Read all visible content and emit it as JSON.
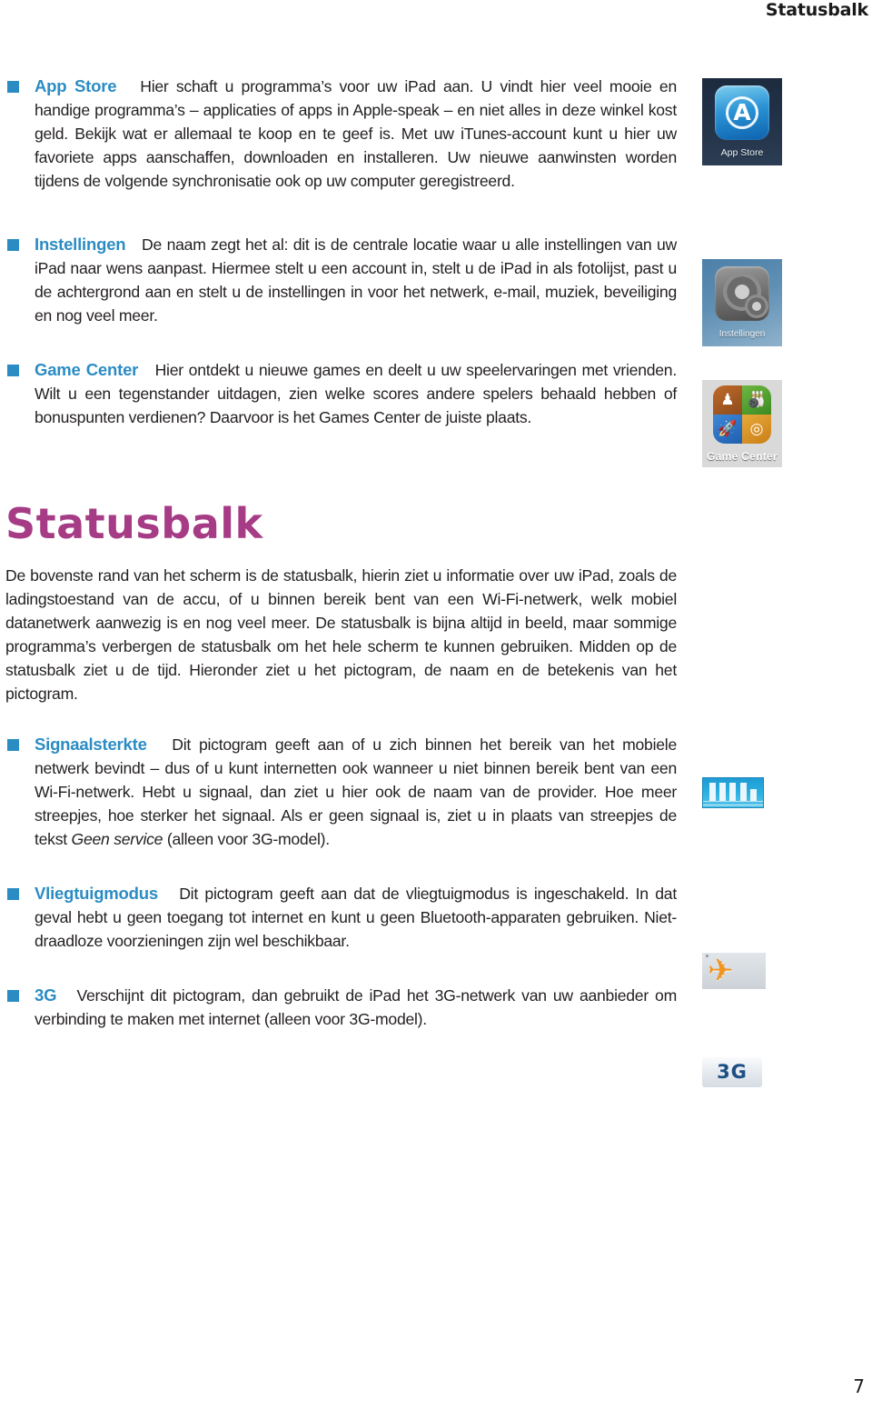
{
  "header": {
    "running_head": "Statusbalk"
  },
  "colors": {
    "term_blue": "#2b8cc4",
    "bullet_blue": "#2b8cc4",
    "heading_magenta": "#a63b86",
    "body_text": "#231f20"
  },
  "entries": [
    {
      "term": "App Store",
      "body": "Hier schaft u programma’s voor uw iPad aan. U vindt hier veel mooie en handige programma’s – applicaties of apps in Apple-speak – en niet alles in deze winkel kost geld. Bekijk wat er allemaal te koop en te geef is. Met uw iTunes-account kunt u hier uw favoriete apps aanschaffen, downloaden en installeren. Uw nieuwe aanwinsten worden tijdens de volgende synchronisatie ook op uw computer geregistreerd.",
      "icon": {
        "name": "app-store-icon",
        "caption": "App Store",
        "glyph": "A"
      }
    },
    {
      "term": "Instellingen",
      "body": "De naam zegt het al: dit is de centrale locatie waar u alle instellingen van uw iPad naar wens aanpast. Hiermee stelt u een account in, stelt u de iPad in als fotolijst, past u de achtergrond aan en stelt u de instellingen in voor het netwerk, e-mail, muziek, beveiliging en nog veel meer.",
      "icon": {
        "name": "settings-gears-icon",
        "caption": "Instellingen"
      }
    },
    {
      "term": "Game Center",
      "body": "Hier ontdekt u nieuwe games en deelt u uw speelervaringen met vrienden. Wilt u een tegenstander uitdagen, zien welke scores andere spelers behaald hebben of bonuspunten verdienen? Daarvoor is het Games Center de juiste plaats.",
      "icon": {
        "name": "game-center-icon",
        "caption": "Game Center",
        "quadrants": [
          "♟",
          "🎳",
          "🚀",
          "◎"
        ]
      }
    }
  ],
  "section": {
    "heading": "Statusbalk",
    "intro": "De bovenste rand van het scherm is de statusbalk, hierin ziet u informatie over uw iPad, zoals de ladingstoestand van de accu, of u binnen bereik bent van een Wi-Fi-netwerk, welk mobiel datanetwerk aanwezig is en nog veel meer. De statusbalk is bijna altijd in beeld, maar sommige programma’s verbergen de statusbalk om het hele scherm te kunnen gebruiken. Midden op de statusbalk ziet u de tijd. Hieronder ziet u het pictogram, de naam en de betekenis van het pictogram."
  },
  "status_entries": [
    {
      "term": "Signaalsterkte",
      "body_before": "Dit pictogram geeft aan of u zich binnen het bereik van het mobiele netwerk bevindt – dus of u kunt internetten ook wanneer u niet binnen bereik bent van een Wi-Fi-netwerk. Hebt u signaal, dan ziet u hier ook de naam van de provider. Hoe meer streepjes, hoe sterker het signaal. Als er geen signaal is, ziet u in plaats van streepjes de tekst ",
      "body_italic": "Geen service",
      "body_after": " (alleen voor 3G-model).",
      "icon": {
        "name": "signal-strength-icon",
        "bars": 5
      }
    },
    {
      "term": "Vliegtuigmodus",
      "body_before": "Dit pictogram geeft aan dat de vliegtuigmodus is ingeschakeld. In dat geval hebt u geen toegang tot internet en kunt u geen Bluetooth-apparaten gebruiken. Niet-draadloze voorzieningen zijn wel beschikbaar.",
      "body_italic": "",
      "body_after": "",
      "icon": {
        "name": "airplane-mode-icon",
        "glyph": "✈"
      }
    },
    {
      "term": "3G",
      "body_before": "Verschijnt dit pictogram, dan gebruikt de iPad het 3G-netwerk van uw aanbieder om verbinding te maken met internet (alleen voor 3G-model).",
      "body_italic": "",
      "body_after": "",
      "icon": {
        "name": "three-g-icon",
        "label": "3G"
      }
    }
  ],
  "folio": {
    "page_number": "7"
  }
}
